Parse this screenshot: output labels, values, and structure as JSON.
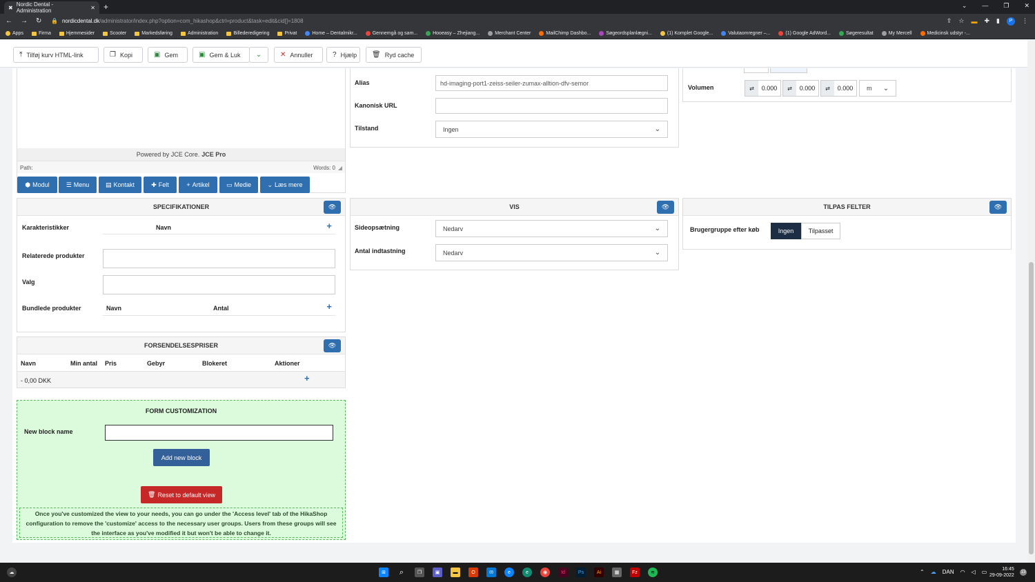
{
  "browser": {
    "tab_title": "Nordic Dental - Administration",
    "url_host": "nordicdental.dk",
    "url_path": "/administrator/index.php?option=com_hikashop&ctrl=product&task=edit&cid[]=1808",
    "profile_initial": "P",
    "bookmarks": [
      "Apps",
      "Firma",
      "Hjemmesider",
      "Scooter",
      "Markedsføring",
      "Administration",
      "Billederedigering",
      "Privat",
      "Home – Dentalmikr...",
      "Gennemgå og sam...",
      "Hooeasy – Zhejiang...",
      "Merchant Center",
      "MailChimp Dashbo...",
      "Søgeordsplanlægni...",
      "(1) Komplet Google...",
      "Valutaomregner –...",
      "(1) Google AdWord...",
      "Søgeresultat",
      "My Mercell",
      "Medicinsk udstyr -..."
    ]
  },
  "toolbar": {
    "add_cart_link": "Tilføj kurv HTML-link",
    "copy": "Kopi",
    "save": "Gem",
    "save_close": "Gem & Luk",
    "cancel": "Annuller",
    "help": "Hjælp",
    "clear_cache": "Ryd cache"
  },
  "editor": {
    "powered_by": "Powered by JCE Core.",
    "powered_pro": "JCE Pro",
    "path_label": "Path:",
    "words_label": "Words: 0",
    "buttons": [
      "Modul",
      "Menu",
      "Kontakt",
      "Felt",
      "Artikel",
      "Medie",
      "Læs mere"
    ]
  },
  "seo": {
    "alias_label": "Alias",
    "alias_value": "hd-imaging-port1-zeiss-seiler-zumax-alltion-dfv-semor",
    "canonical_label": "Kanonisk URL",
    "canonical_value": "",
    "state_label": "Tilstand",
    "state_value": "Ingen"
  },
  "dimensions": {
    "volume_label": "Volumen",
    "values": [
      "0.000",
      "0.000",
      "0.000"
    ],
    "unit": "m"
  },
  "specs": {
    "title": "SPECIFIKATIONER",
    "characteristics_label": "Karakteristikker",
    "name_col": "Navn",
    "related_label": "Relaterede produkter",
    "options_label": "Valg",
    "bundled_label": "Bundlede produkter",
    "bundled_name_col": "Navn",
    "bundled_qty_col": "Antal"
  },
  "display": {
    "title": "VIS",
    "layout_label": "Sideopsætning",
    "layout_value": "Nedarv",
    "qty_label": "Antal indtastning",
    "qty_value": "Nedarv"
  },
  "custom_fields": {
    "title": "TILPAS FELTER",
    "group_label": "Brugergruppe efter køb",
    "option_none": "Ingen",
    "option_custom": "Tilpasset"
  },
  "shipping": {
    "title": "FORSENDELSESPRISER",
    "columns": [
      "Navn",
      "Min antal",
      "Pris",
      "Gebyr",
      "Blokeret",
      "Aktioner"
    ],
    "row_value": "- 0,00 DKK"
  },
  "form_custom": {
    "title": "FORM CUSTOMIZATION",
    "block_name_label": "New block name",
    "block_name_value": "",
    "add_block": "Add new block",
    "reset": "Reset to default view",
    "info": "Once you've customized the view to your needs, you can go under the 'Access level' tab of the HikaShop configuration to remove the 'customize' access to the necessary user groups. Users from these groups will see the interface as you've modified it but won't be able to change it."
  },
  "taskbar": {
    "lang": "DAN",
    "time": "16:45",
    "date": "29-09-2022",
    "notif_count": "13"
  },
  "colors": {
    "primary": "#2f6fb0",
    "dark_btn": "#1d2d44",
    "danger": "#c62828",
    "form_custom_bg": "#dcfadc",
    "form_custom_border": "#5cb85c"
  }
}
